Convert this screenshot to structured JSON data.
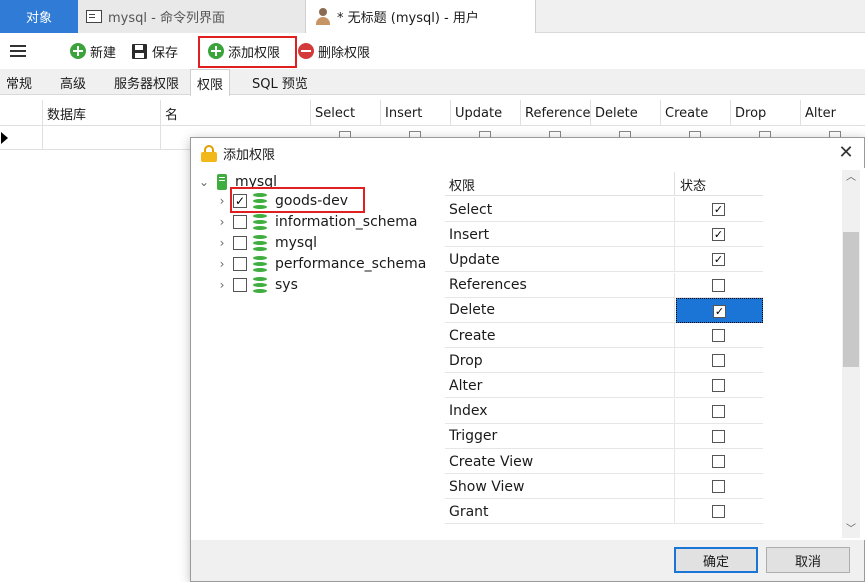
{
  "tabs": {
    "objects": "对象",
    "console": "mysql - 命令列界面",
    "user": "* 无标题 (mysql) - 用户"
  },
  "toolbar": {
    "new_label": "新建",
    "save_label": "保存",
    "add_perm_label": "添加权限",
    "del_perm_label": "删除权限"
  },
  "subtabs": [
    "常规",
    "高级",
    "服务器权限",
    "权限",
    "SQL 预览"
  ],
  "grid": {
    "columns": [
      "数据库",
      "名",
      "Select",
      "Insert",
      "Update",
      "Reference",
      "Delete",
      "Create",
      "Drop",
      "Alter"
    ]
  },
  "dialog": {
    "title": "添加权限",
    "tree": {
      "root": "mysql",
      "databases": [
        {
          "name": "goods-dev",
          "checked": true
        },
        {
          "name": "information_schema",
          "checked": false
        },
        {
          "name": "mysql",
          "checked": false
        },
        {
          "name": "performance_schema",
          "checked": false
        },
        {
          "name": "sys",
          "checked": false
        }
      ]
    },
    "priv_header": {
      "name": "权限",
      "state": "状态"
    },
    "privileges": [
      {
        "name": "Select",
        "checked": true
      },
      {
        "name": "Insert",
        "checked": true
      },
      {
        "name": "Update",
        "checked": true
      },
      {
        "name": "References",
        "checked": false
      },
      {
        "name": "Delete",
        "checked": true,
        "selected": true
      },
      {
        "name": "Create",
        "checked": false
      },
      {
        "name": "Drop",
        "checked": false
      },
      {
        "name": "Alter",
        "checked": false
      },
      {
        "name": "Index",
        "checked": false
      },
      {
        "name": "Trigger",
        "checked": false
      },
      {
        "name": "Create View",
        "checked": false
      },
      {
        "name": "Show View",
        "checked": false
      },
      {
        "name": "Grant",
        "checked": false
      }
    ],
    "ok_label": "确定",
    "cancel_label": "取消"
  },
  "colors": {
    "accent": "#2f7bd6",
    "selection": "#1b75d6",
    "highlight_box": "#e02020",
    "db_icon": "#3fae3f"
  }
}
